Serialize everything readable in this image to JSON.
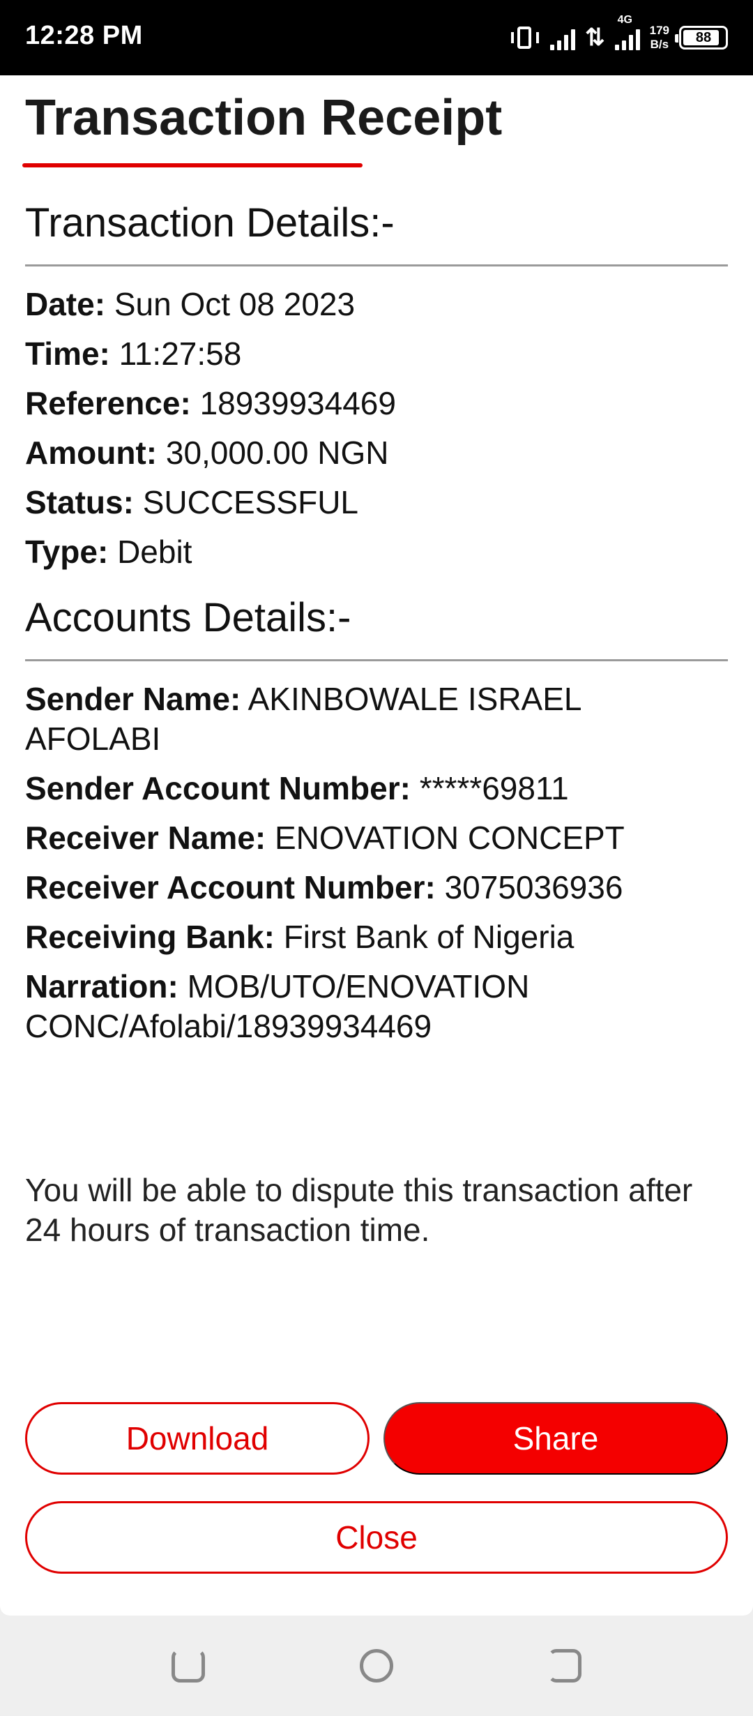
{
  "status_bar": {
    "time": "12:28 PM",
    "network": "4G",
    "speed_value": "179",
    "speed_unit": "B/s",
    "battery": "88",
    "battery_level": 0.88
  },
  "receipt": {
    "title": "Transaction Receipt",
    "transaction_section_title": "Transaction Details:-",
    "transaction_fields": [
      {
        "label": "Date",
        "value": "Sun Oct 08 2023"
      },
      {
        "label": "Time",
        "value": "11:27:58"
      },
      {
        "label": "Reference",
        "value": "18939934469"
      },
      {
        "label": "Amount",
        "value": "30,000.00 NGN"
      },
      {
        "label": "Status",
        "value": "SUCCESSFUL"
      },
      {
        "label": "Type",
        "value": "Debit"
      }
    ],
    "accounts_section_title": "Accounts Details:-",
    "account_fields": [
      {
        "label": "Sender Name",
        "value": "AKINBOWALE ISRAEL AFOLABI"
      },
      {
        "label": "Sender Account Number",
        "value": "*****69811"
      },
      {
        "label": "Receiver Name",
        "value": "ENOVATION CONCEPT"
      },
      {
        "label": "Receiver Account Number",
        "value": "3075036936"
      },
      {
        "label": "Receiving Bank",
        "value": "First Bank of Nigeria"
      },
      {
        "label": "Narration",
        "value": "MOB/UTO/ENOVATION CONC/Afolabi/18939934469"
      }
    ],
    "dispute_note": "You will be able to dispute this transaction after 24 hours of transaction time."
  },
  "actions": {
    "download_label": "Download",
    "share_label": "Share",
    "close_label": "Close"
  },
  "colors": {
    "accent": "#e00000",
    "share_fill": "#f40000"
  }
}
